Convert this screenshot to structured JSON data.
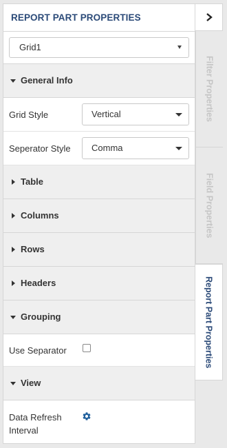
{
  "panel": {
    "title": "REPORT PART PROPERTIES",
    "part_select": {
      "value": "Grid1"
    }
  },
  "sections": {
    "general_info": {
      "label": "General Info",
      "grid_style": {
        "label": "Grid Style",
        "value": "Vertical"
      },
      "separator_style": {
        "label": "Seperator Style",
        "value": "Comma"
      }
    },
    "table": {
      "label": "Table"
    },
    "columns": {
      "label": "Columns"
    },
    "rows": {
      "label": "Rows"
    },
    "headers": {
      "label": "Headers"
    },
    "grouping": {
      "label": "Grouping",
      "use_separator": {
        "label": "Use Separator",
        "checked": false
      }
    },
    "view": {
      "label": "View",
      "data_refresh": {
        "label_line1": "Data Refresh",
        "label_line2": "Interval"
      }
    }
  },
  "side_tabs": {
    "filter": "Filter Properties",
    "field": "Field Properties",
    "report_part": "Report Part Properties"
  },
  "colors": {
    "accent": "#2b4a78",
    "section_bg": "#efefef",
    "icon_blue": "#1f5f9c"
  }
}
